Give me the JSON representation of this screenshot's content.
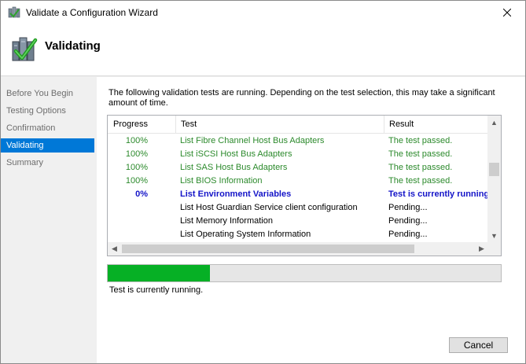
{
  "window": {
    "title": "Validate a Configuration Wizard",
    "icon": "cluster-validation-icon",
    "close_icon": "close-icon"
  },
  "header": {
    "title": "Validating",
    "icon": "validation-checkmark-icon"
  },
  "nav": {
    "items": [
      {
        "label": "Before You Begin",
        "active": false
      },
      {
        "label": "Testing Options",
        "active": false
      },
      {
        "label": "Confirmation",
        "active": false
      },
      {
        "label": "Validating",
        "active": true
      },
      {
        "label": "Summary",
        "active": false
      }
    ]
  },
  "main": {
    "intro": "The following validation tests are running. Depending on the test selection, this may take a significant amount of time.",
    "columns": {
      "progress": "Progress",
      "test": "Test",
      "result": "Result"
    },
    "rows": [
      {
        "progress": "100%",
        "test": "List Fibre Channel Host Bus Adapters",
        "result": "The test passed.",
        "status": "passed"
      },
      {
        "progress": "100%",
        "test": "List iSCSI Host Bus Adapters",
        "result": "The test passed.",
        "status": "passed"
      },
      {
        "progress": "100%",
        "test": "List SAS Host Bus Adapters",
        "result": "The test passed.",
        "status": "passed"
      },
      {
        "progress": "100%",
        "test": "List BIOS Information",
        "result": "The test passed.",
        "status": "passed"
      },
      {
        "progress": "0%",
        "test": "List Environment Variables",
        "result": "Test is currently running",
        "status": "running"
      },
      {
        "progress": "",
        "test": "List Host Guardian Service client configuration",
        "result": "Pending...",
        "status": "pending"
      },
      {
        "progress": "",
        "test": "List Memory Information",
        "result": "Pending...",
        "status": "pending"
      },
      {
        "progress": "",
        "test": "List Operating System Information",
        "result": "Pending...",
        "status": "pending"
      }
    ],
    "overall_progress": 0.26,
    "status_text": "Test is currently running."
  },
  "footer": {
    "cancel_label": "Cancel"
  },
  "colors": {
    "accent": "#0078d7",
    "passed": "#2c8a2c",
    "running": "#1414c8",
    "progress_fill": "#06b025"
  }
}
